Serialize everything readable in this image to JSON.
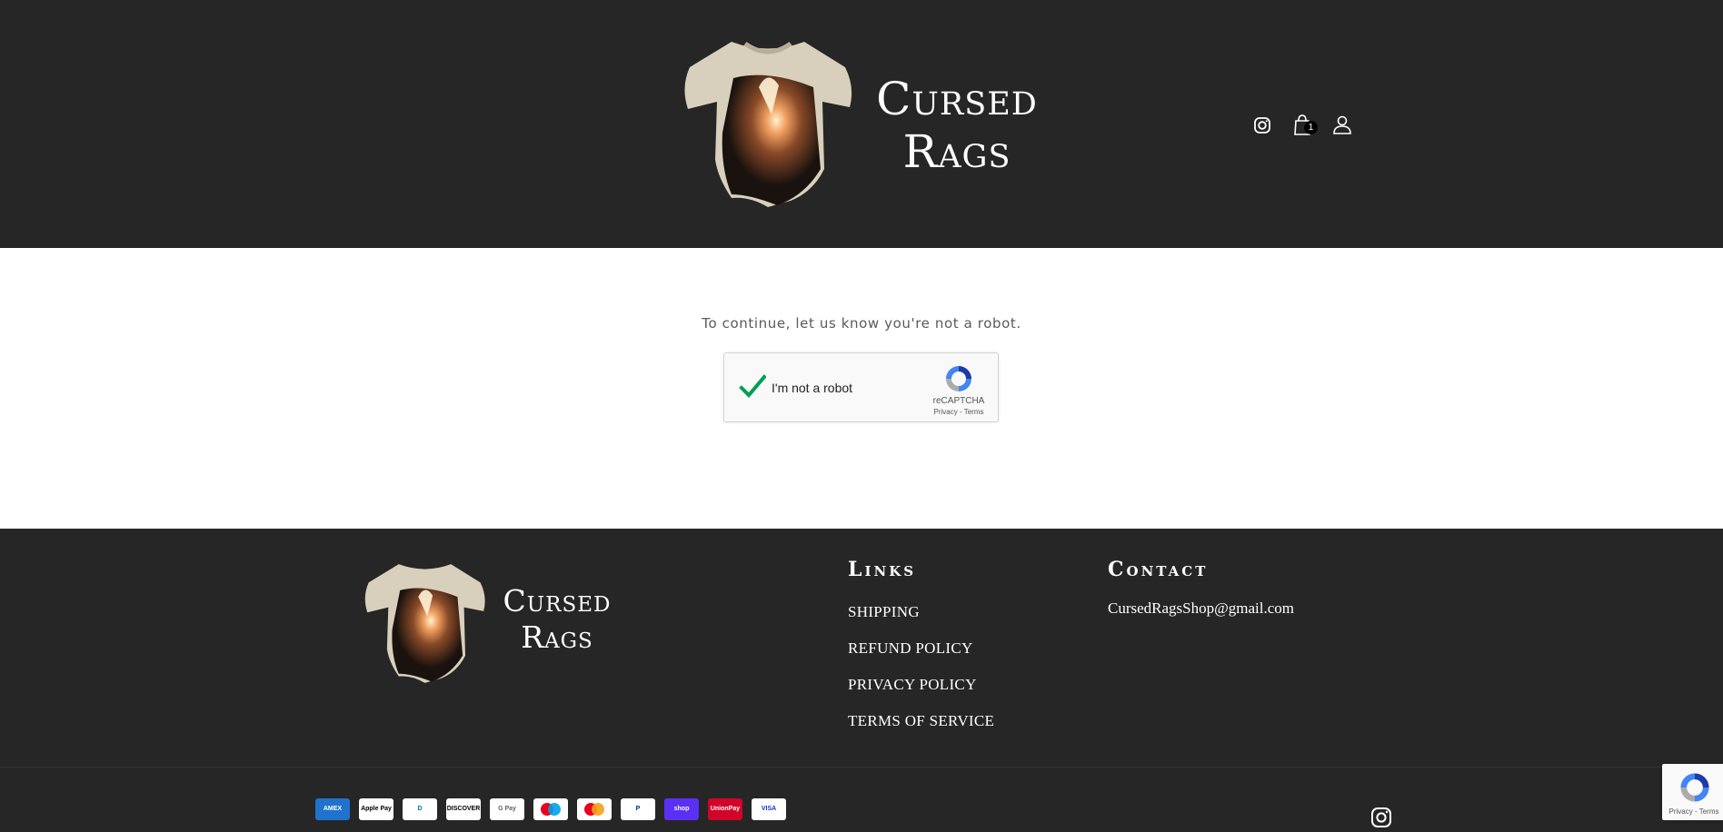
{
  "colors": {
    "header_bg": "#262626",
    "footer_bg": "#262626",
    "main_bg": "#ffffff",
    "text_light": "#ffffff",
    "recaptcha_check": "#009e55"
  },
  "header": {
    "brand_line1": "Cursed",
    "brand_line2": "Rags",
    "icons": [
      "instagram-icon",
      "cart-icon",
      "account-icon"
    ],
    "cart_count": "1"
  },
  "main": {
    "message": "To continue, let us know you're not a robot.",
    "recaptcha": {
      "label": "I'm not a robot",
      "brand": "reCAPTCHA",
      "links": "Privacy - Terms",
      "checked": true
    }
  },
  "footer": {
    "brand_line1": "Cursed",
    "brand_line2": "Rags",
    "links_title": "Links",
    "links": [
      "SHIPPING",
      "REFUND POLICY",
      "PRIVACY POLICY",
      "TERMS OF SERVICE"
    ],
    "contact_title": "Contact",
    "email": "CursedRagsShop@gmail.com",
    "payments": [
      {
        "name": "American Express",
        "label": "AMEX",
        "bg": "#1f72cd",
        "fg": "#ffffff"
      },
      {
        "name": "Apple Pay",
        "label": "Apple Pay",
        "bg": "#ffffff",
        "fg": "#000000"
      },
      {
        "name": "Diners Club",
        "label": "D",
        "bg": "#ffffff",
        "fg": "#0079be"
      },
      {
        "name": "Discover",
        "label": "DISCOVER",
        "bg": "#ffffff",
        "fg": "#000000"
      },
      {
        "name": "Google Pay",
        "label": "G Pay",
        "bg": "#ffffff",
        "fg": "#5f6368"
      },
      {
        "name": "Maestro",
        "label": "",
        "bg": "#ffffff",
        "fg": "#000000"
      },
      {
        "name": "Mastercard",
        "label": "",
        "bg": "#ffffff",
        "fg": "#000000"
      },
      {
        "name": "PayPal",
        "label": "P",
        "bg": "#ffffff",
        "fg": "#003087"
      },
      {
        "name": "Shop Pay",
        "label": "shop",
        "bg": "#5a31f4",
        "fg": "#ffffff"
      },
      {
        "name": "UnionPay",
        "label": "UnionPay",
        "bg": "#d10429",
        "fg": "#ffffff"
      },
      {
        "name": "Visa",
        "label": "VISA",
        "bg": "#ffffff",
        "fg": "#1434cb"
      }
    ],
    "recaptcha_badge_links": "Privacy - Terms"
  }
}
